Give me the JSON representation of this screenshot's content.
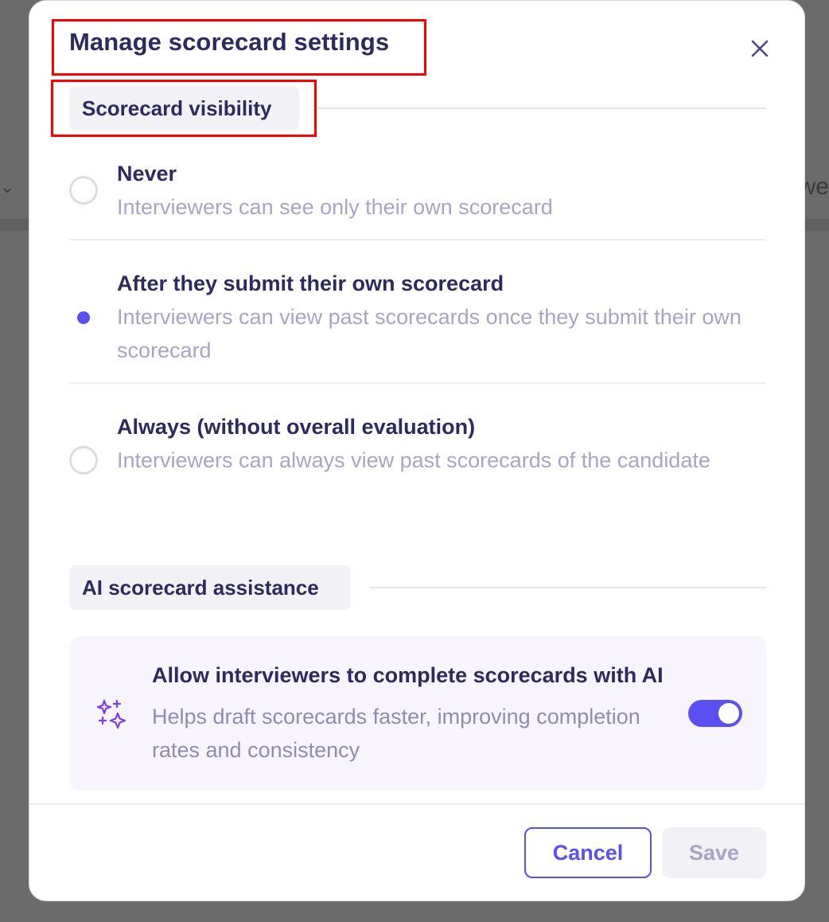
{
  "modal": {
    "title": "Manage scorecard settings",
    "close_icon": "close-icon"
  },
  "visibility": {
    "section_label": "Scorecard visibility",
    "options": [
      {
        "title": "Never",
        "description": "Interviewers can see only their own scorecard",
        "selected": false
      },
      {
        "title": "After they submit their own scorecard",
        "description": "Interviewers can view past scorecards once they submit their own scorecard",
        "selected": true
      },
      {
        "title": "Always (without overall evaluation)",
        "description": "Interviewers can always view past scorecards of the candidate",
        "selected": false
      }
    ]
  },
  "ai": {
    "section_label": "AI scorecard assistance",
    "setting_title": "Allow interviewers to complete scorecards with AI",
    "setting_description": "Helps draft scorecards faster, improving completion rates and consistency",
    "enabled": true,
    "icon": "sparkles-icon"
  },
  "footer": {
    "cancel_label": "Cancel",
    "save_label": "Save"
  },
  "colors": {
    "accent": "#5a4ff0",
    "title_text": "#2d2a5e",
    "muted_text": "#a7a5c4",
    "highlight_box": "#ff0000",
    "ai_card_bg": "#f8f4fd"
  }
}
